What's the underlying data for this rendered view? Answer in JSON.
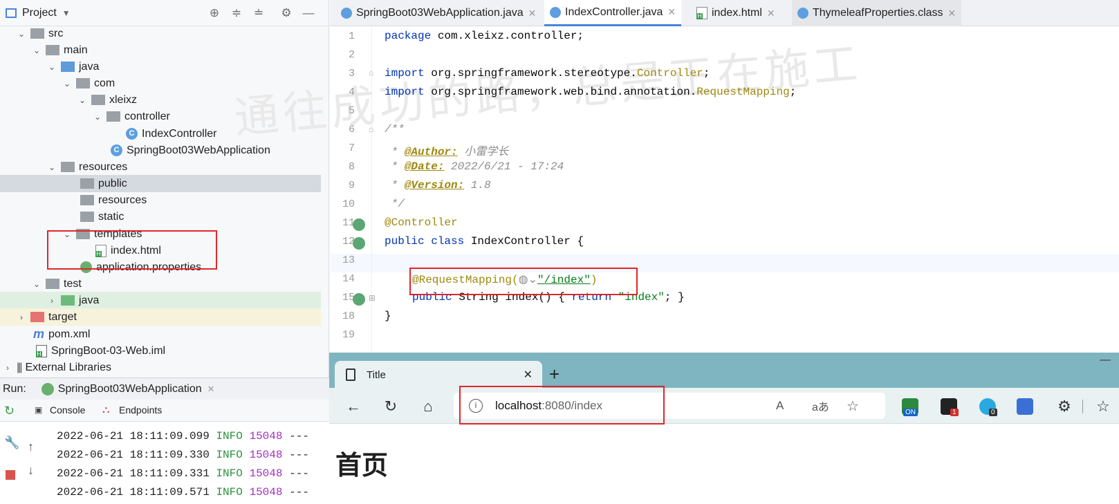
{
  "project": {
    "title": "Project",
    "tree": [
      {
        "label": "src"
      },
      {
        "label": "main"
      },
      {
        "label": "java"
      },
      {
        "label": "com"
      },
      {
        "label": "xleixz"
      },
      {
        "label": "controller"
      },
      {
        "label": "IndexController"
      },
      {
        "label": "SpringBoot03WebApplication"
      },
      {
        "label": "resources"
      },
      {
        "label": "public"
      },
      {
        "label": "resources"
      },
      {
        "label": "static"
      },
      {
        "label": "templates"
      },
      {
        "label": "index.html"
      },
      {
        "label": "application.properties"
      },
      {
        "label": "test"
      },
      {
        "label": "java"
      },
      {
        "label": "target"
      },
      {
        "label": "pom.xml"
      },
      {
        "label": "SpringBoot-03-Web.iml"
      },
      {
        "label": "External Libraries"
      }
    ]
  },
  "run": {
    "label": "Run:",
    "config": "SpringBoot03WebApplication",
    "console_tab": "Console",
    "endpoints_tab": "Endpoints",
    "logs": [
      {
        "time": "2022-06-21 18:11:09.099",
        "level": "INFO",
        "pid": "15048",
        "rest": "---"
      },
      {
        "time": "2022-06-21 18:11:09.330",
        "level": "INFO",
        "pid": "15048",
        "rest": "---"
      },
      {
        "time": "2022-06-21 18:11:09.331",
        "level": "INFO",
        "pid": "15048",
        "rest": "---"
      },
      {
        "time": "2022-06-21 18:11:09.571",
        "level": "INFO",
        "pid": "15048",
        "rest": "---"
      }
    ]
  },
  "editor": {
    "tabs": [
      "SpringBoot03WebApplication.java",
      "IndexController.java",
      "index.html",
      "ThymeleafProperties.class"
    ],
    "line_numbers": [
      "1",
      "2",
      "3",
      "4",
      "5",
      "6",
      "7",
      "8",
      "9",
      "10",
      "11",
      "12",
      "13",
      "14",
      "15",
      "18",
      "19"
    ],
    "code": {
      "l1_kw": "package",
      "l1_rest": " com.xleixz.controller;",
      "l3_kw": "import",
      "l3_rest": " org.springframework.stereotype.",
      "l3_ann": "Controller",
      "l3_end": ";",
      "l4_kw": "import",
      "l4_rest": " org.springframework.web.bind.annotation.",
      "l4_ann": "RequestMapping",
      "l4_end": ";",
      "l6": "/**",
      "l7_pre": " * ",
      "l7_tag": "@Author:",
      "l7_val": " 小雷学长",
      "l8_pre": " * ",
      "l8_tag": "@Date:",
      "l8_val": " 2022/6/21 - 17:24",
      "l9_pre": " * ",
      "l9_tag": "@Version:",
      "l9_val": " 1.8",
      "l10": " */",
      "l11": "@Controller",
      "l12_kw": "public class",
      "l12_rest": " IndexController {",
      "l14_ann": "@RequestMapping(",
      "l14_str": "\"/index\"",
      "l14_end": ")",
      "l15_kw": "public",
      "l15_mid": " String index() { ",
      "l15_kw2": "return",
      "l15_str": " \"index\"",
      "l15_end": "; }",
      "l18": "}"
    },
    "watermark": "通往成功的路，总是正在施工"
  },
  "browser": {
    "tab_title": "Title",
    "url_host": "localhost",
    "url_rest": ":8080/index",
    "ext_badge_1": "ON",
    "ext_badge_2": "1",
    "ext_badge_3": "0",
    "page_heading": "首页"
  }
}
